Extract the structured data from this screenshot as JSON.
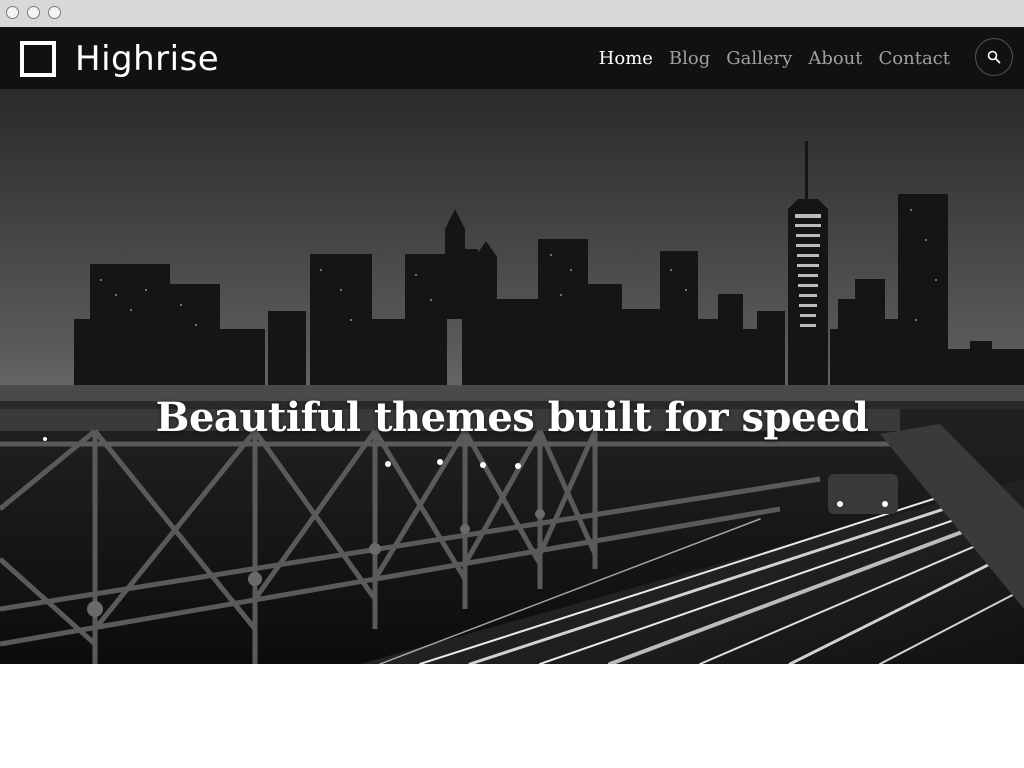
{
  "site": {
    "name": "Highrise"
  },
  "nav": {
    "items": [
      {
        "label": "Home",
        "active": true
      },
      {
        "label": "Blog",
        "active": false
      },
      {
        "label": "Gallery",
        "active": false
      },
      {
        "label": "About",
        "active": false
      },
      {
        "label": "Contact",
        "active": false
      }
    ]
  },
  "search": {
    "icon": "search-icon"
  },
  "hero": {
    "title": "Beautiful themes built for speed",
    "image": "black-and-white city skyline at night from bridge with light trails"
  },
  "colors": {
    "header_bg": "#111111",
    "nav_active": "#ffffff",
    "nav_inactive": "#a0a0a0",
    "chrome_bg": "#d8d8d8"
  }
}
